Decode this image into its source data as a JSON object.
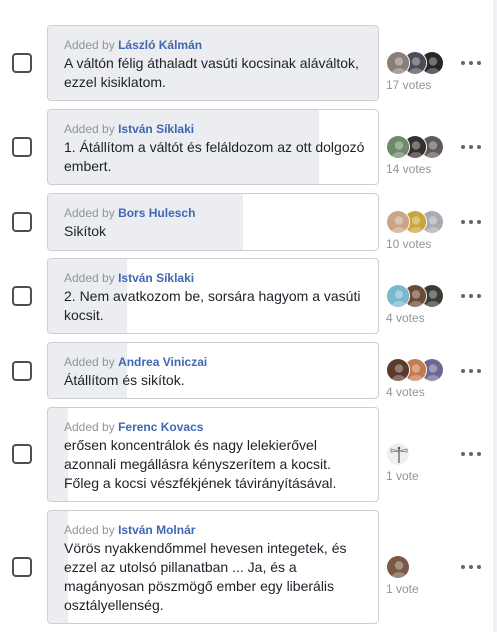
{
  "colors": {
    "author": "#4267b2",
    "muted": "#90949c",
    "vote_fill": "#ebedf0",
    "card_border": "#ccd0d5"
  },
  "added_by_prefix": "Added by",
  "options": [
    {
      "author": "László Kálmán",
      "text": "A váltón félig áthaladt vasúti kocsinak aláváltok, ezzel kisiklatom.",
      "votes_label": "17 votes",
      "vote_fraction": 1.0,
      "avatars": [
        {
          "icon": "avatar-person",
          "color": "#8a7f78"
        },
        {
          "icon": "avatar-person",
          "color": "#4a4d55"
        },
        {
          "icon": "avatar-person",
          "color": "#2b2526"
        }
      ]
    },
    {
      "author": "István Síklaki",
      "text": "1. Átállítom a váltót és feláldozom az ott dolgozó embert.",
      "votes_label": "14 votes",
      "vote_fraction": 0.82,
      "avatars": [
        {
          "icon": "avatar-person",
          "color": "#6f8a6a"
        },
        {
          "icon": "avatar-person",
          "color": "#35302d"
        },
        {
          "icon": "avatar-person",
          "color": "#5f5a57"
        }
      ]
    },
    {
      "author": "Bors Hulesch",
      "text": "Sikítok",
      "votes_label": "10 votes",
      "vote_fraction": 0.59,
      "avatars": [
        {
          "icon": "avatar-person",
          "color": "#c9a487"
        },
        {
          "icon": "avatar-person",
          "color": "#c8a63c"
        },
        {
          "icon": "avatar-person",
          "color": "#a8abaf"
        }
      ]
    },
    {
      "author": "István Síklaki",
      "text": "2. Nem avatkozom be, sorsára hagyom a vasúti kocsit.",
      "votes_label": "4 votes",
      "vote_fraction": 0.24,
      "avatars": [
        {
          "icon": "avatar-person",
          "color": "#79b7cf"
        },
        {
          "icon": "avatar-person",
          "color": "#6b4a3a"
        },
        {
          "icon": "avatar-person",
          "color": "#3b3a33"
        }
      ]
    },
    {
      "author": "Andrea Viniczai",
      "text": "Átállítom és sikítok.",
      "votes_label": "4 votes",
      "vote_fraction": 0.24,
      "avatars": [
        {
          "icon": "avatar-person",
          "color": "#5a3a2c"
        },
        {
          "icon": "avatar-person",
          "color": "#c47a4e"
        },
        {
          "icon": "avatar-person",
          "color": "#6c6690"
        }
      ]
    },
    {
      "author": "Ferenc Kovacs",
      "text": "erősen koncentrálok és nagy lelekierővel azonnali megállásra kényszerítem a kocsit. Főleg a kocsi vészfékjének távirányításával.",
      "votes_label": "1 vote",
      "vote_fraction": 0.06,
      "avatars": [
        {
          "icon": "avatar-dragonfly",
          "color": "#eef0ee"
        }
      ]
    },
    {
      "author": "István Molnár",
      "text": "Vörös nyakkendőmmel hevesen integetek, és ezzel az utolsó pillanatban ... Ja, és a magányosan pöszmögő ember egy liberális osztályellenség.",
      "votes_label": "1 vote",
      "vote_fraction": 0.06,
      "avatars": [
        {
          "icon": "avatar-person",
          "color": "#7a5844"
        }
      ]
    }
  ]
}
